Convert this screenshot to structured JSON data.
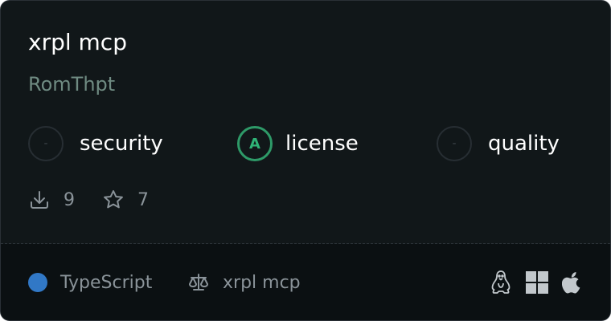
{
  "server": {
    "name": "xrpl mcp",
    "author": "RomThpt"
  },
  "scores": [
    {
      "label": "security",
      "grade": "-"
    },
    {
      "label": "license",
      "grade": "A"
    },
    {
      "label": "quality",
      "grade": "-"
    }
  ],
  "stats": {
    "downloads": "9",
    "stars": "7"
  },
  "footer": {
    "language": "TypeScript",
    "language_color": "#3178c6",
    "license_name": "xrpl mcp",
    "platforms": [
      "linux-icon",
      "windows-icon",
      "apple-icon"
    ]
  },
  "colors": {
    "background": "#111719",
    "grade_a": "#2e9a68",
    "author": "#6f8b82"
  }
}
